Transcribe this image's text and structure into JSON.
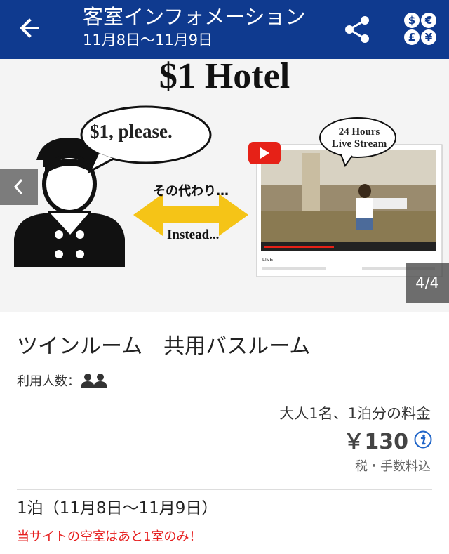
{
  "header": {
    "title": "客室インフォメーション",
    "subtitle": "11月8日〜11月9日",
    "icons": [
      "back-arrow-icon",
      "share-icon",
      "currency-icon"
    ],
    "currency_symbols": [
      "$",
      "€",
      "£",
      "¥"
    ],
    "color": "#0f3a8f"
  },
  "gallery": {
    "image_title": "$1 Hotel",
    "speech_bubble": "$1, please.",
    "stream_bubble_line1": "24 Hours",
    "stream_bubble_line2": "Live Stream",
    "arrow_text_ja": "その代わり…",
    "arrow_text_en": "Instead...",
    "video_label": "LIVE",
    "counter": "4/4",
    "prev_icon": "chevron-left-icon"
  },
  "room": {
    "name": "ツインルーム　共用バスルーム",
    "guests_label": "利用人数：",
    "guests_icon": "two-people-icon"
  },
  "pricing": {
    "note": "大人1名、1泊分の料金",
    "price": "￥130",
    "info_icon": "info-icon",
    "tax_note": "税・手数料込"
  },
  "stay": {
    "nights": "1泊（11月8日〜11月9日）",
    "availability": "当サイトの空室はあと1室のみ！",
    "availability_color": "#e61e1e"
  }
}
